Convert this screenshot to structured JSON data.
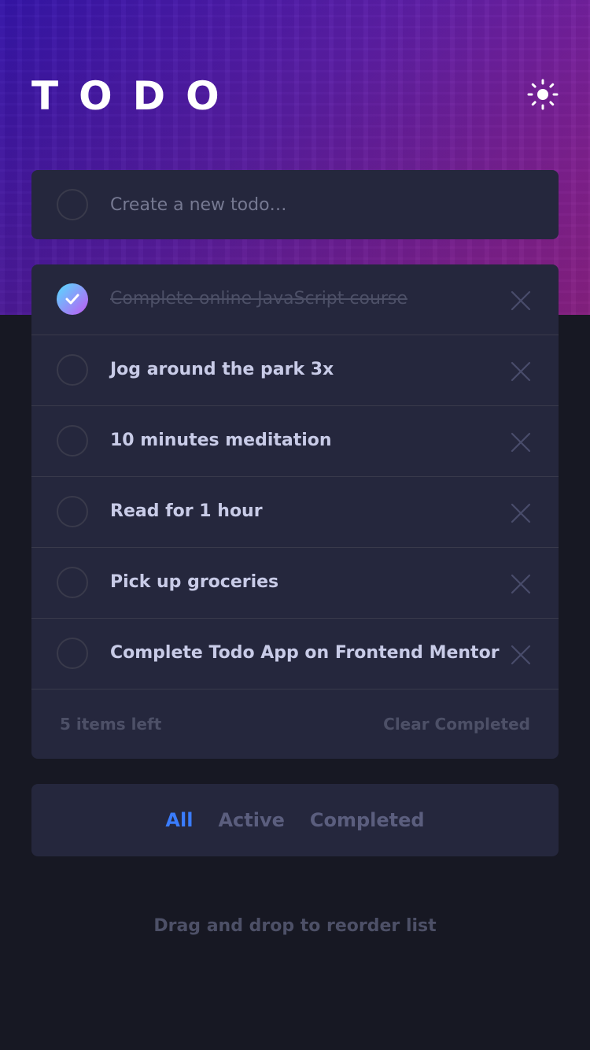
{
  "app": {
    "title": "TODO"
  },
  "icons": {
    "theme_toggle": "sun-icon",
    "check": "check-icon",
    "delete": "cross-icon"
  },
  "colors": {
    "background": "#171823",
    "card": "#25273d",
    "accent": "#3a7cfd",
    "check_gradient_start": "#55ddff",
    "check_gradient_end": "#c058f3"
  },
  "new_todo": {
    "placeholder": "Create a new todo…",
    "value": ""
  },
  "todos": [
    {
      "text": "Complete online JavaScript course",
      "completed": true
    },
    {
      "text": "Jog around the park 3x",
      "completed": false
    },
    {
      "text": "10 minutes meditation",
      "completed": false
    },
    {
      "text": "Read for 1 hour",
      "completed": false
    },
    {
      "text": "Pick up groceries",
      "completed": false
    },
    {
      "text": "Complete Todo App on Frontend Mentor",
      "completed": false
    }
  ],
  "footer": {
    "items_left": "5 items left",
    "clear_completed": "Clear Completed"
  },
  "filters": {
    "all": "All",
    "active": "Active",
    "completed": "Completed",
    "selected": "All"
  },
  "hint": "Drag and drop to reorder list"
}
